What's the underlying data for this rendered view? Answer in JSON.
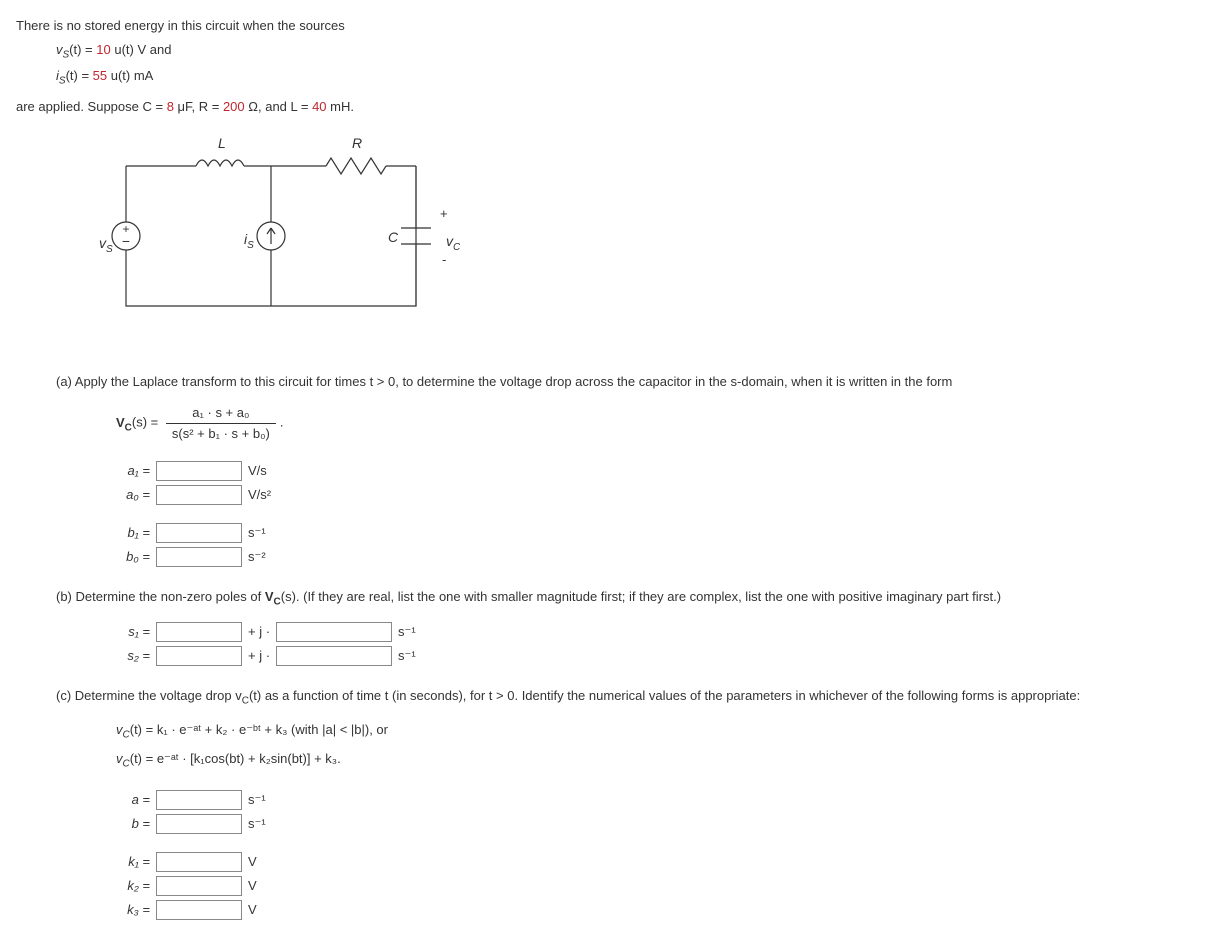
{
  "intro": {
    "line1": "There is no stored energy in this circuit when the sources",
    "vs_prefix": "v",
    "vs_sub": "S",
    "vs_t": "(t) = ",
    "vs_val": "10",
    "vs_unit": " u(t) V and",
    "is_prefix": "i",
    "is_sub": "S",
    "is_t": "(t) = ",
    "is_val": "55",
    "is_unit": " u(t) mA",
    "applied_prefix": "are applied. Suppose C = ",
    "c_val": "8",
    "c_unit": " μF, R = ",
    "r_val": "200",
    "r_unit": " Ω, and L = ",
    "l_val": "40",
    "l_unit": " mH."
  },
  "fig": {
    "L": "L",
    "R": "R",
    "vs": "v",
    "vs_sub": "S",
    "is": "i",
    "is_sub": "S",
    "C": "C",
    "vc": "v",
    "vc_sub": "C",
    "plus": "+",
    "minus": "-"
  },
  "partA": {
    "text": "(a) Apply the Laplace transform to this circuit for times t > 0, to determine the voltage drop across the capacitor in the s-domain, when it is written in the form",
    "vc_label": "V",
    "vc_sub": "C",
    "vc_arg": "(s) = ",
    "num": "a₁ · s + a₀",
    "den": "s(s² + b₁ · s + b₀)",
    "a1_label": "a₁ =",
    "a1_unit": "V/s",
    "a0_label": "a₀ =",
    "a0_unit": "V/s²",
    "b1_label": "b₁ =",
    "b1_unit": "s⁻¹",
    "b0_label": "b₀ =",
    "b0_unit": "s⁻²"
  },
  "partB": {
    "text": "(b) Determine the non-zero poles of ",
    "vc_bold": "V",
    "vc_sub": "C",
    "vc_arg": "(s). (If they are real, list the one with smaller magnitude first; if they are complex, list the one with positive imaginary part first.)",
    "s1_label": "s₁ =",
    "plus_j": "+ j ·",
    "unit": "s⁻¹",
    "s2_label": "s₂ ="
  },
  "partC": {
    "text": "(c) Determine the voltage drop v",
    "vc_sub": "C",
    "text2": "(t) as a function of time t (in seconds), for t > 0. Identify the numerical values of the parameters in whichever of the following forms is appropriate:",
    "form1_pre": "v",
    "form1": "(t) = k₁ · e⁻ᵃᵗ + k₂ · e⁻ᵇᵗ + k₃ (with |a| < |b|), or",
    "form2": "(t) = e⁻ᵃᵗ · [k₁cos(bt) + k₂sin(bt)] + k₃.",
    "a_label": "a =",
    "a_unit": "s⁻¹",
    "b_label": "b =",
    "b_unit": "s⁻¹",
    "k1_label": "k₁ =",
    "k1_unit": "V",
    "k2_label": "k₂ =",
    "k2_unit": "V",
    "k3_label": "k₃ =",
    "k3_unit": "V"
  }
}
